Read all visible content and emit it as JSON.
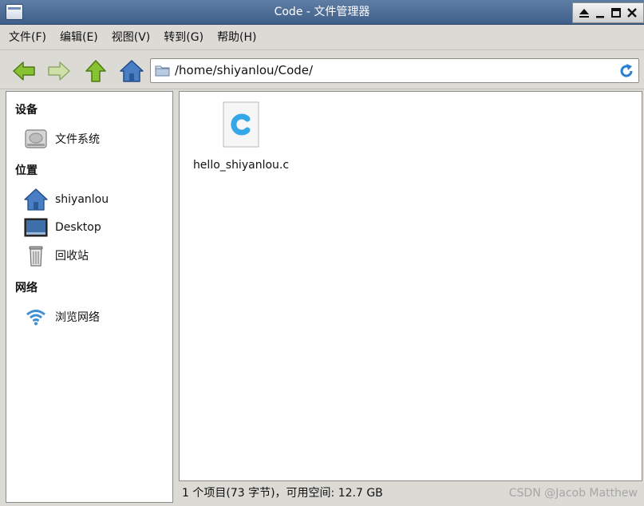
{
  "window": {
    "title": "Code - 文件管理器"
  },
  "menu": [
    {
      "label": "文件(F)"
    },
    {
      "label": "编辑(E)"
    },
    {
      "label": "视图(V)"
    },
    {
      "label": "转到(G)"
    },
    {
      "label": "帮助(H)"
    }
  ],
  "toolbar": {
    "path": "/home/shiyanlou/Code/"
  },
  "sidebar": {
    "devices_heading": "设备",
    "devices": [
      {
        "label": "文件系统",
        "icon": "harddisk-icon"
      }
    ],
    "places_heading": "位置",
    "places": [
      {
        "label": "shiyanlou",
        "icon": "home-folder-icon"
      },
      {
        "label": "Desktop",
        "icon": "desktop-icon"
      },
      {
        "label": "回收站",
        "icon": "trash-icon"
      }
    ],
    "network_heading": "网络",
    "network": [
      {
        "label": "浏览网络",
        "icon": "network-icon"
      }
    ]
  },
  "files": [
    {
      "name": "hello_shiyanlou.c",
      "icon": "c-source-file-icon"
    }
  ],
  "status": {
    "text": "1 个项目(73 字节)，可用空间: 12.7 GB"
  },
  "watermark": "CSDN @Jacob Matthew",
  "colors": {
    "titlebar": "#4b6c97",
    "accent_green": "#7dbb2c",
    "folder_blue": "#4a7ec4",
    "c_icon": "#35a6e6"
  }
}
